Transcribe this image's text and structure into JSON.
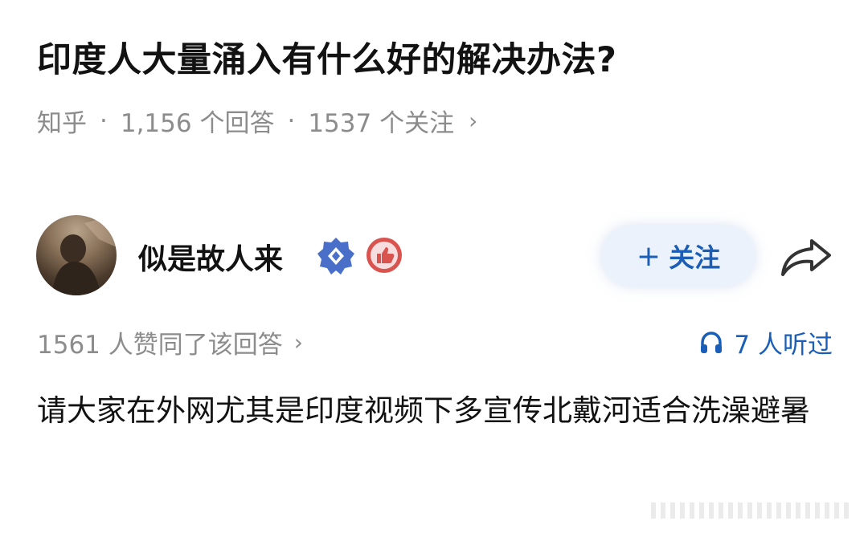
{
  "question": {
    "title": "印度人大量涌入有什么好的解决办法?",
    "source": "知乎",
    "answers": "1,156 个回答",
    "followers": "1537 个关注"
  },
  "author": {
    "name": "似是故人来",
    "follow_label": "关注"
  },
  "stats": {
    "likes": "1561 人赞同了该回答",
    "listeners": "7 人听过"
  },
  "answer": {
    "text": "请大家在外网尤其是印度视频下多宣传北戴河适合洗澡避暑"
  },
  "icons": {
    "share": "share-icon",
    "headphones": "headphones-icon",
    "verified": "verified-badge-icon",
    "thumb": "thumbs-up-badge-icon"
  },
  "colors": {
    "accent": "#1a5eb8",
    "meta": "#8c8c8c",
    "badge_blue": "#4a6fc9",
    "badge_red": "#d9534f"
  }
}
